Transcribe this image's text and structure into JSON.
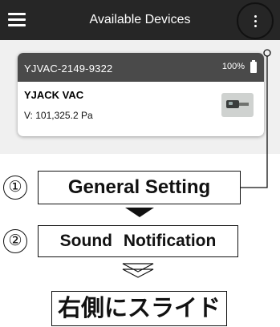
{
  "appbar": {
    "title": "Available Devices",
    "menu_icon": "hamburger-menu-icon",
    "more_icon": "more-vertical-icon"
  },
  "device": {
    "serial": "YJVAC-2149-9322",
    "battery": "100%",
    "battery_icon": "battery-full-icon",
    "name": "YJACK VAC",
    "value": "V: 101,325.2  Pa"
  },
  "steps": [
    {
      "number": "①",
      "label": "General Setting"
    },
    {
      "number": "②",
      "label": "Sound  Notification"
    }
  ],
  "final_instruction": "右側にスライド",
  "colors": {
    "appbar": "#262626",
    "card_header": "#4a4a4a",
    "background": "#f0f0f0"
  }
}
